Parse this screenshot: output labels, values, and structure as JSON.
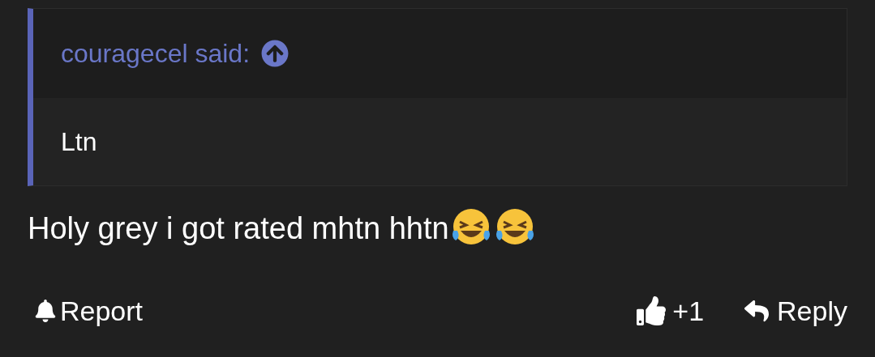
{
  "quote": {
    "author": "couragecel said:",
    "body": "Ltn"
  },
  "message": {
    "text": "Holy grey i got rated mhtn hhtn",
    "emojis": [
      {
        "kind": "laugh-cry"
      },
      {
        "kind": "laugh-cry"
      }
    ]
  },
  "actions": {
    "report": "Report",
    "like_count": "+1",
    "reply": "Reply"
  }
}
